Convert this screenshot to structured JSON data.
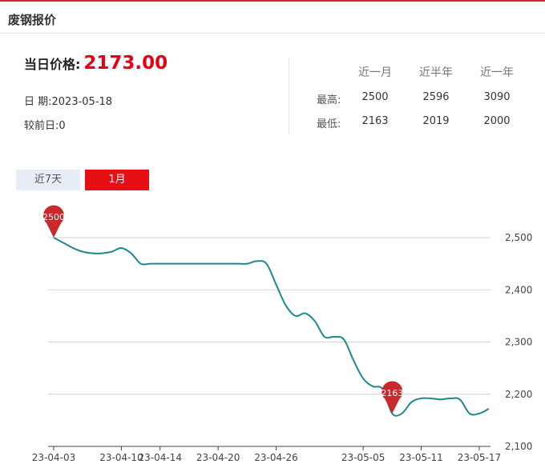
{
  "header": {
    "title": "废钢报价"
  },
  "summary": {
    "price_label": "当日价格:",
    "price_value": "2173.00",
    "date_label": "日 期:",
    "date_value": "2023-05-18",
    "change_label": "较前日:",
    "change_value": "0"
  },
  "stats": {
    "headers": [
      "近一月",
      "近半年",
      "近一年"
    ],
    "high_label": "最高:",
    "low_label": "最低:",
    "high": [
      "2500",
      "2596",
      "3090"
    ],
    "low": [
      "2163",
      "2019",
      "2000"
    ]
  },
  "tabs": [
    {
      "label": "近7天",
      "active": false
    },
    {
      "label": "1月",
      "active": true
    }
  ],
  "colors": {
    "accent": "#e50f14",
    "line": "#1b8a8c",
    "pin": "#c9282d"
  },
  "chart_data": {
    "type": "line",
    "x": [
      "2023-04-03",
      "2023-04-04",
      "2023-04-05",
      "2023-04-06",
      "2023-04-07",
      "2023-04-08",
      "2023-04-09",
      "2023-04-10",
      "2023-04-11",
      "2023-04-12",
      "2023-04-13",
      "2023-04-14",
      "2023-04-15",
      "2023-04-16",
      "2023-04-17",
      "2023-04-18",
      "2023-04-19",
      "2023-04-20",
      "2023-04-21",
      "2023-04-22",
      "2023-04-23",
      "2023-04-24",
      "2023-04-25",
      "2023-04-26",
      "2023-04-27",
      "2023-04-28",
      "2023-04-29",
      "2023-04-30",
      "2023-05-01",
      "2023-05-02",
      "2023-05-03",
      "2023-05-04",
      "2023-05-05",
      "2023-05-06",
      "2023-05-07",
      "2023-05-08",
      "2023-05-09",
      "2023-05-10",
      "2023-05-11",
      "2023-05-12",
      "2023-05-13",
      "2023-05-14",
      "2023-05-15",
      "2023-05-16",
      "2023-05-17",
      "2023-05-18"
    ],
    "values": [
      2500,
      2490,
      2480,
      2473,
      2470,
      2470,
      2473,
      2480,
      2470,
      2450,
      2450,
      2450,
      2450,
      2450,
      2450,
      2450,
      2450,
      2450,
      2450,
      2450,
      2450,
      2455,
      2450,
      2410,
      2370,
      2350,
      2355,
      2340,
      2310,
      2310,
      2305,
      2265,
      2230,
      2215,
      2210,
      2163,
      2163,
      2185,
      2192,
      2192,
      2190,
      2192,
      2190,
      2163,
      2163,
      2172
    ],
    "x_ticks": [
      "23-04-03",
      "23-04-10",
      "23-04-14",
      "23-04-20",
      "23-04-26",
      "23-05-05",
      "23-05-11",
      "23-05-17"
    ],
    "y_ticks": [
      "2,500",
      "2,400",
      "2,300",
      "2,200",
      "2,100"
    ],
    "ylim": [
      2100,
      2500
    ],
    "markers": [
      {
        "label": "2500",
        "value": 2500,
        "date": "2023-04-03"
      },
      {
        "label": "2163",
        "value": 2163,
        "date": "2023-05-08"
      }
    ],
    "grid": true
  }
}
